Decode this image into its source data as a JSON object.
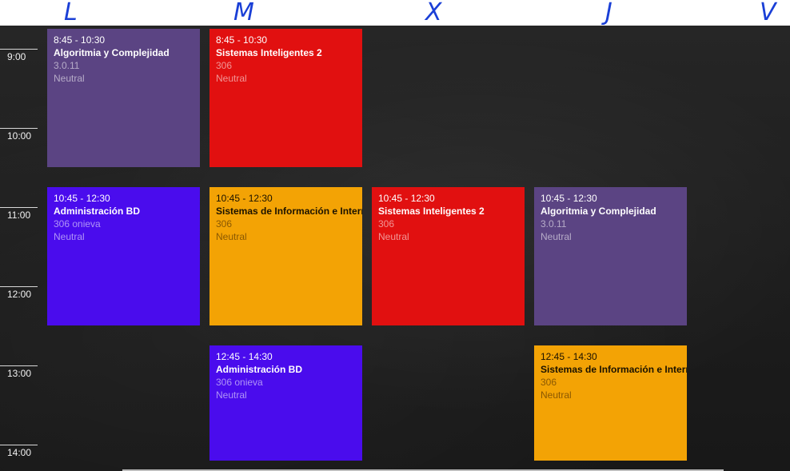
{
  "days": [
    "L",
    "M",
    "X",
    "J",
    "V"
  ],
  "times": [
    "9:00",
    "10:00",
    "11:00",
    "12:00",
    "13:00",
    "14:00"
  ],
  "colors": {
    "purple": "#5b4483",
    "red": "#e11010",
    "blue": "#4a0ced",
    "orange": "#f3a305"
  },
  "events": [
    {
      "time": "8:45 - 10:30",
      "title": "Algoritmia y Complejidad",
      "room": "3.0.11",
      "status": "Neutral",
      "color": "purple"
    },
    {
      "time": "8:45 - 10:30",
      "title": "Sistemas Inteligentes 2",
      "room": "306",
      "status": "Neutral",
      "color": "red"
    },
    {
      "time": "10:45 - 12:30",
      "title": "Administración BD",
      "room": "306 onieva",
      "status": "Neutral",
      "color": "blue"
    },
    {
      "time": "10:45 - 12:30",
      "title": "Sistemas de Información e Interr",
      "room": "306",
      "status": "Neutral",
      "color": "orange"
    },
    {
      "time": "10:45 - 12:30",
      "title": "Sistemas Inteligentes 2",
      "room": "306",
      "status": "Neutral",
      "color": "red"
    },
    {
      "time": "10:45 - 12:30",
      "title": "Algoritmia y Complejidad",
      "room": "3.0.11",
      "status": "Neutral",
      "color": "purple"
    },
    {
      "time": "12:45 - 14:30",
      "title": "Administración BD",
      "room": "306 onieva",
      "status": "Neutral",
      "color": "blue"
    },
    {
      "time": "12:45 - 14:30",
      "title": "Sistemas de Información e Interr",
      "room": "306",
      "status": "Neutral",
      "color": "orange"
    }
  ]
}
